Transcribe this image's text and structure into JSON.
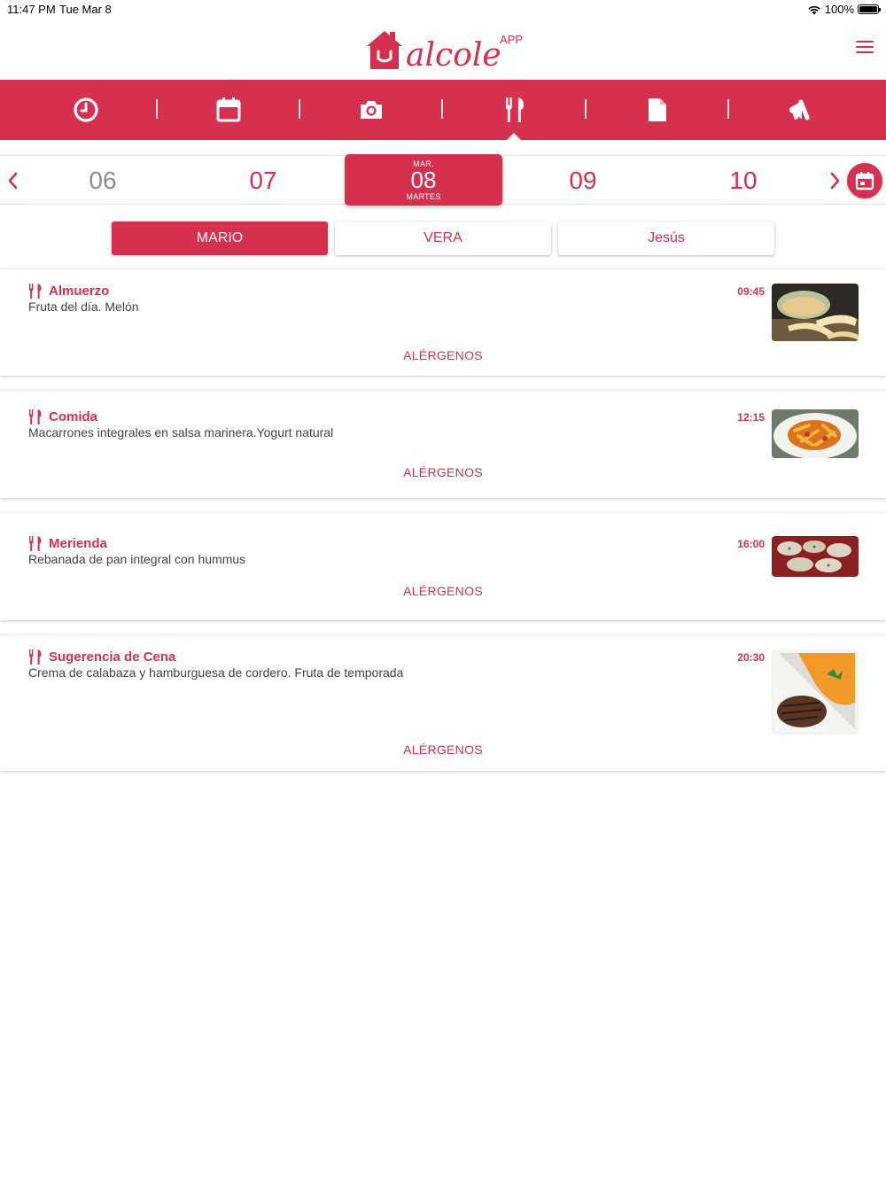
{
  "status_bar": {
    "time": "11:47 PM",
    "date": "Tue Mar 8",
    "battery": "100%"
  },
  "header": {
    "logo_text": "alcole",
    "logo_badge": "APP"
  },
  "nav": {
    "items": [
      {
        "icon": "clock-icon"
      },
      {
        "icon": "calendar-icon"
      },
      {
        "icon": "camera-icon"
      },
      {
        "icon": "cutlery-icon",
        "active": true
      },
      {
        "icon": "document-icon"
      },
      {
        "icon": "megaphone-icon"
      }
    ]
  },
  "date_strip": {
    "days": [
      "06",
      "07",
      "09",
      "10"
    ],
    "selected": {
      "month": "MAR.",
      "day": "08",
      "weekday": "MARTES"
    }
  },
  "kids": {
    "tabs": [
      "MARIO",
      "VERA",
      "Jesús"
    ],
    "active": "MARIO"
  },
  "meals": [
    {
      "title": "Almuerzo",
      "description": "Fruta del día. Melón",
      "time": "09:45",
      "allergens": "ALÉRGENOS",
      "photo": "melon-photo"
    },
    {
      "title": "Comida",
      "description": "Macarrones integrales en salsa marinera.Yogurt natural",
      "time": "12:15",
      "allergens": "ALÉRGENOS",
      "photo": "pasta-photo"
    },
    {
      "title": "Merienda",
      "description": "Rebanada de pan integral con hummus",
      "time": "16:00",
      "allergens": "ALÉRGENOS",
      "photo": "bread-hummus-photo"
    },
    {
      "title": "Sugerencia de Cena",
      "description": "Crema de calabaza y hamburguesa de cordero. Fruta de temporada",
      "time": "20:30",
      "allergens": "ALÉRGENOS",
      "photo": "soup-burger-photo"
    }
  ],
  "colors": {
    "brand": "#d6304f",
    "past_day": "#8d8d8d"
  }
}
